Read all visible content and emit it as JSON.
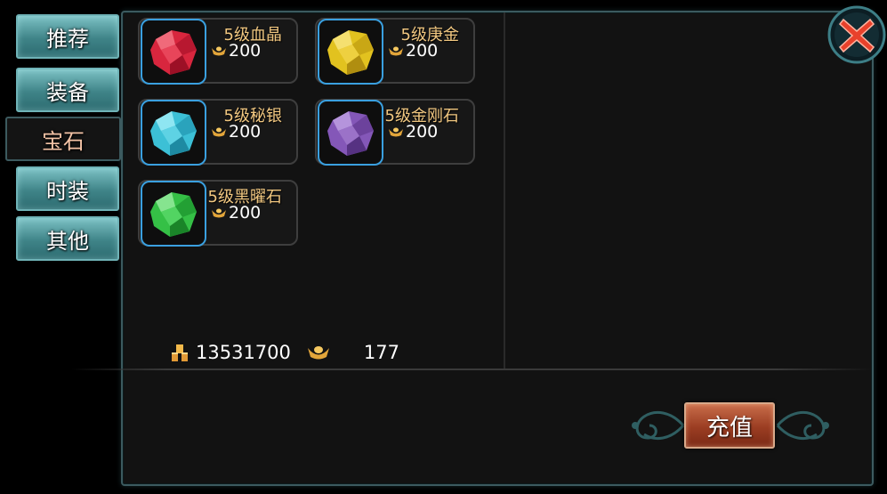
{
  "tabs": [
    {
      "label": "推荐",
      "active": false
    },
    {
      "label": "装备",
      "active": false
    },
    {
      "label": "宝石",
      "active": true
    },
    {
      "label": "时装",
      "active": false
    },
    {
      "label": "其他",
      "active": false
    }
  ],
  "items": [
    {
      "name": "5级血晶",
      "price": "200",
      "gem_color": "#d8263e",
      "icon": "red-gem-icon"
    },
    {
      "name": "5级庚金",
      "price": "200",
      "gem_color": "#e2c21f",
      "icon": "yellow-gem-icon"
    },
    {
      "name": "5级秘银",
      "price": "200",
      "gem_color": "#3cc0d6",
      "icon": "cyan-gem-icon"
    },
    {
      "name": "5级金刚石",
      "price": "200",
      "gem_color": "#8457b8",
      "icon": "purple-gem-icon"
    },
    {
      "name": "5级黑曜石",
      "price": "200",
      "gem_color": "#35c046",
      "icon": "green-gem-icon"
    }
  ],
  "currency": {
    "gold_amount": "13531700",
    "ingot_amount": "177"
  },
  "recharge_label": "充值",
  "colors": {
    "tab_bg": "#3f8488",
    "accent_blue": "#3aa0e0",
    "item_name": "#f1c780",
    "recharge": "#9b3d22"
  }
}
